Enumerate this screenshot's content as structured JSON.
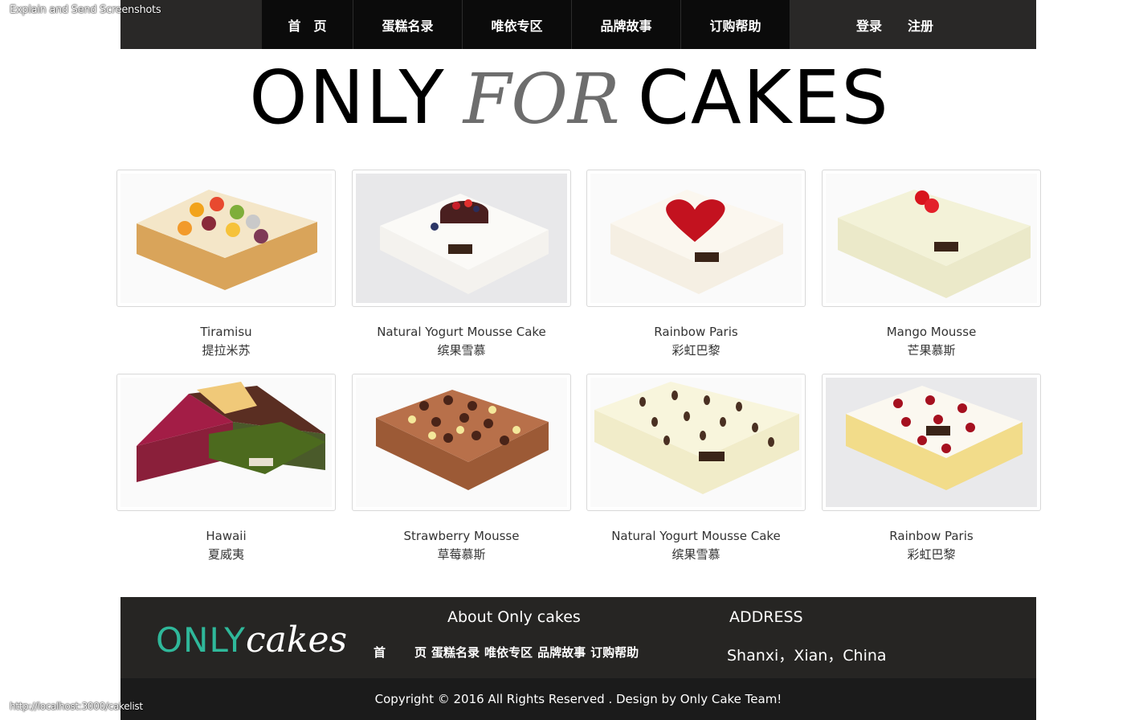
{
  "browser": {
    "extension_note": "Explain and Send Screenshots",
    "status_url": "http://localhost:3000/cakelist"
  },
  "nav": {
    "items": [
      "首　页",
      "蛋糕名录",
      "唯依专区",
      "品牌故事",
      "订购帮助"
    ],
    "login": "登录",
    "register": "注册"
  },
  "logo": {
    "w1": "ONLY",
    "w2": "FOR",
    "w3": "CAKES"
  },
  "cakes": [
    {
      "en": "Tiramisu",
      "zh": "提拉米苏"
    },
    {
      "en": "Natural Yogurt Mousse Cake",
      "zh": "缤果雪慕"
    },
    {
      "en": "Rainbow Paris",
      "zh": "彩虹巴黎"
    },
    {
      "en": "Mango Mousse",
      "zh": "芒果慕斯"
    },
    {
      "en": "Hawaii",
      "zh": "夏威夷"
    },
    {
      "en": "Strawberry Mousse",
      "zh": "草莓慕斯"
    },
    {
      "en": "Natural Yogurt Mousse Cake",
      "zh": "缤果雪慕"
    },
    {
      "en": "Rainbow Paris",
      "zh": "彩虹巴黎"
    }
  ],
  "footer": {
    "logo_a": "ONLY",
    "logo_b": "cakes",
    "about_title": "About Only cakes",
    "links": [
      "首",
      "页",
      "蛋糕名录",
      "唯依专区",
      "品牌故事",
      "订购帮助"
    ],
    "address_title": "ADDRESS",
    "address": "Shanxi，Xian，China",
    "copyright": "Copyright © 2016 All Rights Reserved . Design by Only Cake Team!"
  },
  "colors": {
    "nav_bg": "#292827",
    "nav_item_bg": "#0b0b0b",
    "footer_bg": "#262523",
    "brand_green": "#2fb89a"
  }
}
